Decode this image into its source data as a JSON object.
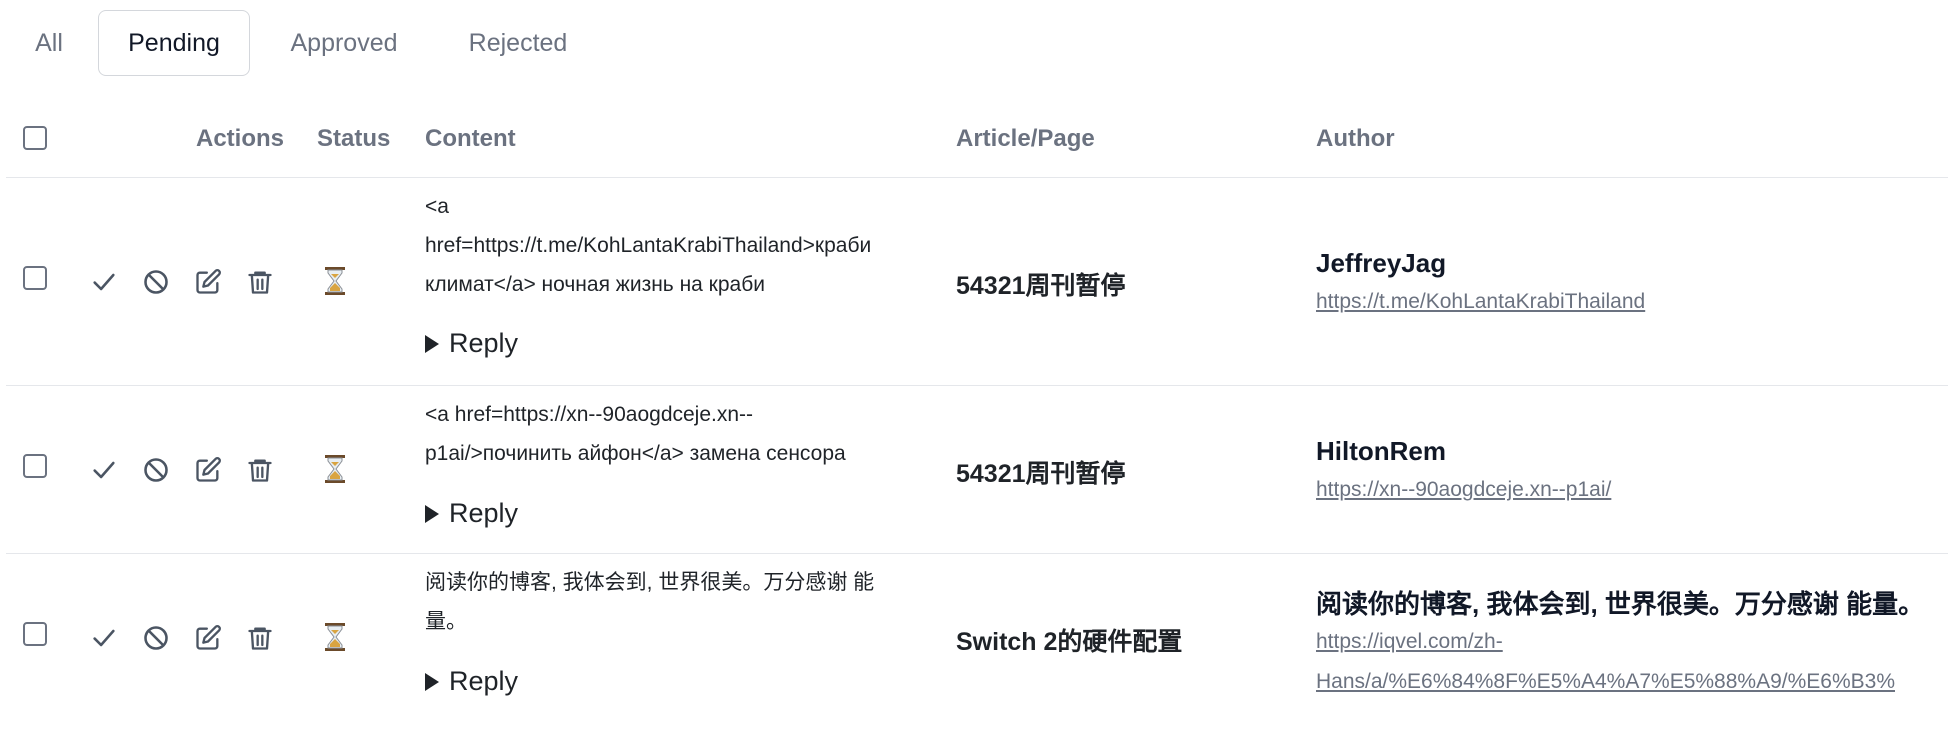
{
  "tabs": [
    {
      "label": "All",
      "active": false
    },
    {
      "label": "Pending",
      "active": true
    },
    {
      "label": "Approved",
      "active": false
    },
    {
      "label": "Rejected",
      "active": false
    }
  ],
  "columns": {
    "actions": "Actions",
    "status": "Status",
    "content": "Content",
    "article": "Article/Page",
    "author": "Author"
  },
  "reply_label": "Reply",
  "icons": {
    "approve": "check-icon",
    "reject": "ban-icon",
    "edit": "edit-icon",
    "delete": "trash-icon",
    "status": "hourglass-icon"
  },
  "colors": {
    "icon": "#4b5563",
    "muted": "#6b7280",
    "border": "#e5e7eb",
    "hourglass_frame": "#6b4a2a",
    "hourglass_sand": "#d9a441"
  },
  "comments": [
    {
      "content_lines": [
        "<a",
        "href=https://t.me/KohLantaKrabiThailand>краби",
        "климат</a> ночная жизнь на краби"
      ],
      "article": "54321周刊暂停",
      "author_name": "JeffreyJag",
      "author_url_lines": [
        "https://t.me/KohLantaKrabiThailand"
      ]
    },
    {
      "content_lines": [
        "<a href=https://xn--90aogdceje.xn--",
        "p1ai/>починить айфон</a> замена сенсора"
      ],
      "article": "54321周刊暂停",
      "author_name": "HiltonRem",
      "author_url_lines": [
        "https://xn--90aogdceje.xn--p1ai/"
      ]
    },
    {
      "content_lines": [
        "阅读你的博客, 我体会到, 世界很美。万分感谢 能",
        "量。"
      ],
      "article": "Switch 2的硬件配置",
      "author_name": "阅读你的博客, 我体会到, 世界很美。万分感谢 能量。",
      "author_url_lines": [
        "https://iqvel.com/zh-",
        "Hans/a/%E6%84%8F%E5%A4%A7%E5%88%A9/%E6%B3%"
      ]
    }
  ]
}
